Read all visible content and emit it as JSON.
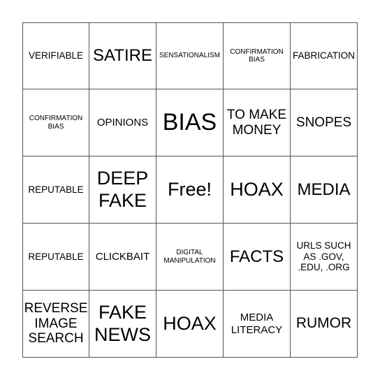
{
  "board": {
    "cells": [
      {
        "text": "VERIFIABLE",
        "size": "s-sm"
      },
      {
        "text": "SATIRE",
        "size": "s-lg"
      },
      {
        "text": "SENSATIONALISM",
        "size": "s-xs"
      },
      {
        "text": "CONFIRMATION BIAS",
        "size": "s-xs"
      },
      {
        "text": "FABRICATION",
        "size": "s-sm"
      },
      {
        "text": "CONFIRMATION BIAS",
        "size": "s-xs"
      },
      {
        "text": "OPINIONS",
        "size": "s-smb"
      },
      {
        "text": "BIAS",
        "size": "s-xxl"
      },
      {
        "text": "TO MAKE MONEY",
        "size": "s-md"
      },
      {
        "text": "SNOPES",
        "size": "s-md"
      },
      {
        "text": "REPUTABLE",
        "size": "s-sm"
      },
      {
        "text": "DEEP FAKE",
        "size": "s-xl"
      },
      {
        "text": "Free!",
        "size": "s-xl"
      },
      {
        "text": "HOAX",
        "size": "s-xl"
      },
      {
        "text": "MEDIA",
        "size": "s-lg"
      },
      {
        "text": "REPUTABLE",
        "size": "s-sm"
      },
      {
        "text": "CLICKBAIT",
        "size": "s-smb"
      },
      {
        "text": "DIGITAL MANIPULATION",
        "size": "s-xs"
      },
      {
        "text": "FACTS",
        "size": "s-lg"
      },
      {
        "text": "URLS SUCH AS .GOV, .EDU, .ORG",
        "size": "s-sm"
      },
      {
        "text": "REVERSE IMAGE SEARCH",
        "size": "s-md"
      },
      {
        "text": "FAKE NEWS",
        "size": "s-xl"
      },
      {
        "text": "HOAX",
        "size": "s-xl"
      },
      {
        "text": "MEDIA LITERACY",
        "size": "s-smb"
      },
      {
        "text": "RUMOR",
        "size": "s-mdl"
      }
    ]
  }
}
